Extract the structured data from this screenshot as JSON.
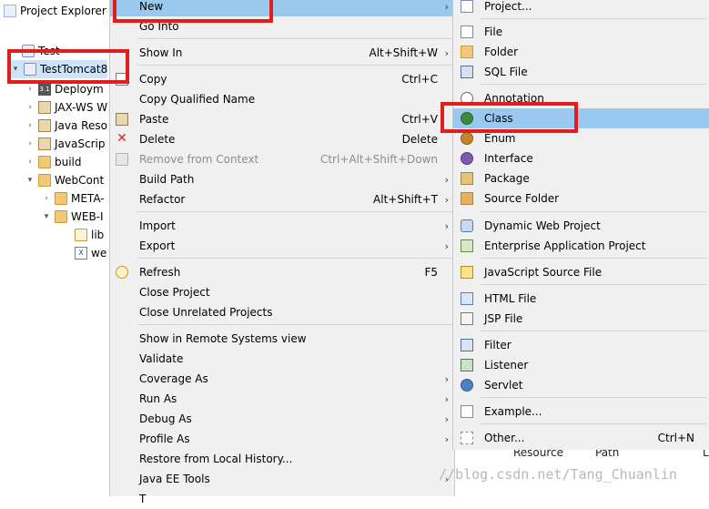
{
  "explorer": {
    "title": "Project Explorer",
    "items": [
      {
        "label": "Test"
      },
      {
        "label": "TestTomcat8"
      },
      {
        "label": "Deploym"
      },
      {
        "label": "JAX-WS W"
      },
      {
        "label": "Java Reso"
      },
      {
        "label": "JavaScrip"
      },
      {
        "label": "build"
      },
      {
        "label": "WebCont"
      },
      {
        "label": "META-"
      },
      {
        "label": "WEB-I"
      },
      {
        "label": "lib"
      },
      {
        "label": "we"
      }
    ]
  },
  "menu": {
    "items": [
      {
        "label": "New",
        "accel": ""
      },
      {
        "label": "Go Into",
        "accel": ""
      },
      {
        "label": "Show In",
        "accel": "Alt+Shift+W"
      },
      {
        "label": "Copy",
        "accel": "Ctrl+C"
      },
      {
        "label": "Copy Qualified Name",
        "accel": ""
      },
      {
        "label": "Paste",
        "accel": "Ctrl+V"
      },
      {
        "label": "Delete",
        "accel": "Delete"
      },
      {
        "label": "Remove from Context",
        "accel": "Ctrl+Alt+Shift+Down"
      },
      {
        "label": "Build Path",
        "accel": ""
      },
      {
        "label": "Refactor",
        "accel": "Alt+Shift+T"
      },
      {
        "label": "Import",
        "accel": ""
      },
      {
        "label": "Export",
        "accel": ""
      },
      {
        "label": "Refresh",
        "accel": "F5"
      },
      {
        "label": "Close Project",
        "accel": ""
      },
      {
        "label": "Close Unrelated Projects",
        "accel": ""
      },
      {
        "label": "Show in Remote Systems view",
        "accel": ""
      },
      {
        "label": "Validate",
        "accel": ""
      },
      {
        "label": "Coverage As",
        "accel": ""
      },
      {
        "label": "Run As",
        "accel": ""
      },
      {
        "label": "Debug As",
        "accel": ""
      },
      {
        "label": "Profile As",
        "accel": ""
      },
      {
        "label": "Restore from Local History...",
        "accel": ""
      },
      {
        "label": "Java EE Tools",
        "accel": ""
      },
      {
        "label": "T",
        "accel": ""
      }
    ]
  },
  "submenu": {
    "items": [
      {
        "label": "Project...",
        "accel": ""
      },
      {
        "label": "File",
        "accel": ""
      },
      {
        "label": "Folder",
        "accel": ""
      },
      {
        "label": "SQL File",
        "accel": ""
      },
      {
        "label": "Annotation",
        "accel": ""
      },
      {
        "label": "Class",
        "accel": ""
      },
      {
        "label": "Enum",
        "accel": ""
      },
      {
        "label": "Interface",
        "accel": ""
      },
      {
        "label": "Package",
        "accel": ""
      },
      {
        "label": "Source Folder",
        "accel": ""
      },
      {
        "label": "Dynamic Web Project",
        "accel": ""
      },
      {
        "label": "Enterprise Application Project",
        "accel": ""
      },
      {
        "label": "JavaScript Source File",
        "accel": ""
      },
      {
        "label": "HTML File",
        "accel": ""
      },
      {
        "label": "JSP File",
        "accel": ""
      },
      {
        "label": "Filter",
        "accel": ""
      },
      {
        "label": "Listener",
        "accel": ""
      },
      {
        "label": "Servlet",
        "accel": ""
      },
      {
        "label": "Example...",
        "accel": ""
      },
      {
        "label": "Other...",
        "accel": "Ctrl+N"
      }
    ]
  },
  "background": {
    "resource_col": "Resource",
    "path_col": "Path",
    "loc_col": "L",
    "watermark": "//blog.csdn.net/Tang_Chuanlin"
  },
  "colors": {
    "highlight": "#99c9ef",
    "menu_bg": "#f0f0f0",
    "annotation_red": "#e01e1e"
  }
}
